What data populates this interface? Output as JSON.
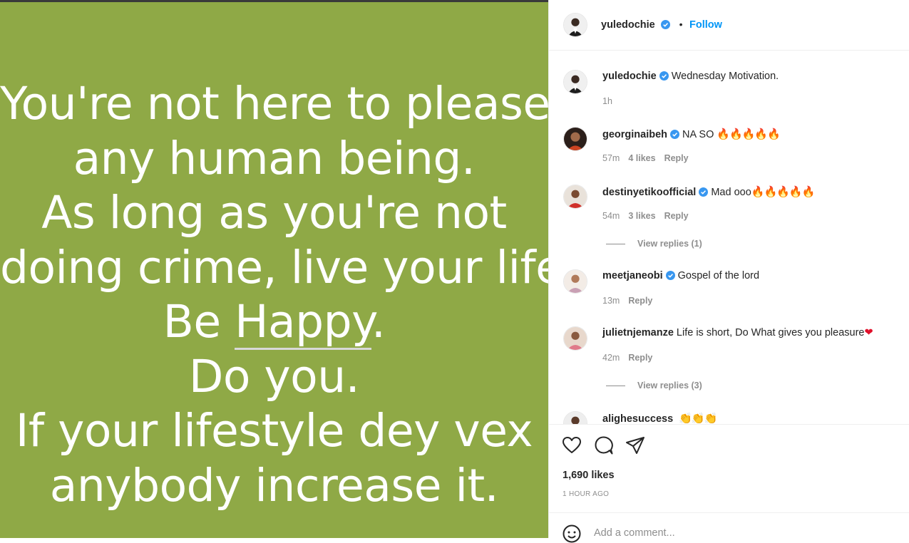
{
  "post_image": {
    "quote_lines": [
      "You're not here to please",
      "any human being.",
      "As long as you're not",
      "doing crime, live your life.",
      "Be ",
      "Happy",
      ".",
      "Do you.",
      "If your lifestyle dey vex",
      "anybody increase it."
    ],
    "background_color": "#8fa946"
  },
  "header": {
    "username": "yuledochie",
    "separator": "•",
    "follow_label": "Follow"
  },
  "comments": [
    {
      "username": "yuledochie",
      "text": "Wednesday Motivation.",
      "time": "1h",
      "verified": true
    },
    {
      "username": "georginaibeh",
      "text": "NA SO",
      "emoji": "🔥🔥🔥🔥🔥",
      "time": "57m",
      "likes": "4 likes",
      "reply": "Reply",
      "verified": true
    },
    {
      "username": "destinyetikoofficial",
      "text": "Mad ooo",
      "emoji": "🔥🔥🔥🔥🔥",
      "time": "54m",
      "likes": "3 likes",
      "reply": "Reply",
      "verified": true,
      "view_replies": "View replies (1)"
    },
    {
      "username": "meetjaneobi",
      "text": "Gospel of the lord",
      "time": "13m",
      "reply": "Reply",
      "verified": true
    },
    {
      "username": "julietnjemanze",
      "text": "Life is short, Do What gives you pleasure",
      "emoji": "❤",
      "time": "42m",
      "reply": "Reply",
      "verified": false,
      "view_replies": "View replies (3)"
    },
    {
      "username": "alighesuccess",
      "text": "",
      "emoji": "👏👏👏",
      "verified": false
    }
  ],
  "actions": {
    "icons": [
      "heart-icon",
      "comment-icon",
      "share-icon"
    ],
    "likes": "1,690 likes",
    "time_ago": "1 HOUR AGO"
  },
  "add_comment": {
    "placeholder": "Add a comment..."
  },
  "colors": {
    "accent": "#0095f6",
    "verified": "#3897f0",
    "muted": "#8e8e8e"
  }
}
